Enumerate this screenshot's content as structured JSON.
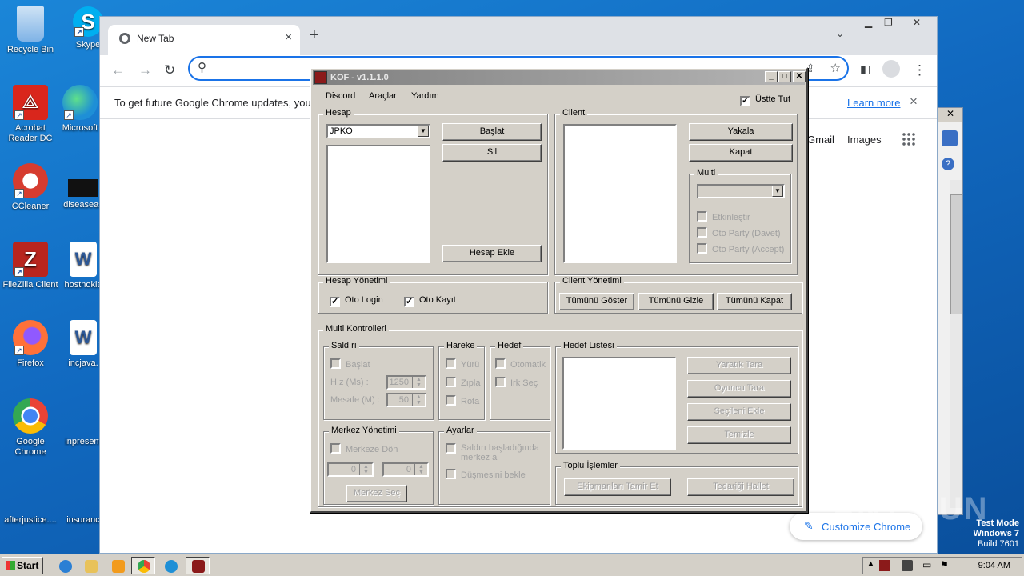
{
  "desktop": {
    "icons": [
      {
        "label": "Recycle Bin",
        "color": "#7fb3e6"
      },
      {
        "label": "Skype",
        "color": "#00aff0"
      },
      {
        "label": "Acrobat Reader DC",
        "color": "#d9261c"
      },
      {
        "label": "Microsoft",
        "color": "#1e8fd6"
      },
      {
        "label": "CCleaner",
        "color": "#d63c2f"
      },
      {
        "label": "diseaseas",
        "color": "#111111"
      },
      {
        "label": "FileZilla Client",
        "color": "#b8251e"
      },
      {
        "label": "hostnokia",
        "color": "#2b5797"
      },
      {
        "label": "Firefox",
        "color": "#ff7139"
      },
      {
        "label": "incjava.",
        "color": "#2b5797"
      },
      {
        "label": "Google Chrome",
        "color": "#4285f4"
      },
      {
        "label": "inpresent",
        "color": "#2b5797"
      },
      {
        "label": "afterjustice....",
        "color": "#1573c7"
      },
      {
        "label": "insuranc",
        "color": "#1573c7"
      }
    ]
  },
  "chrome": {
    "tab_title": "New Tab",
    "tab_close": "×",
    "new_tab": "+",
    "tab_dropdown": "⌄",
    "infobar_message": "To get future Google Chrome updates, you'll",
    "learn_more": "Learn more",
    "infobar_close": "×",
    "gmail": "Gmail",
    "images": "Images",
    "customize": "Customize Chrome"
  },
  "kof": {
    "title": "KOF - v1.1.1.0",
    "menu": [
      "Discord",
      "Araçlar",
      "Yardım"
    ],
    "always_on_top": "Üstte Tut",
    "hesap": {
      "label": "Hesap",
      "selected": "JPKO",
      "baslat": "Başlat",
      "sil": "Sil",
      "hesap_ekle": "Hesap Ekle"
    },
    "client": {
      "label": "Client",
      "yakala": "Yakala",
      "kapat": "Kapat",
      "multi": "Multi",
      "etkinlestir": "Etkinleştir",
      "oto_party_davet": "Oto Party (Davet)",
      "oto_party_accept": "Oto Party (Accept)"
    },
    "hesap_yonetimi": {
      "label": "Hesap Yönetimi",
      "oto_login": "Oto Login",
      "oto_kayit": "Oto Kayıt"
    },
    "client_yonetimi": {
      "label": "Client Yönetimi",
      "tumunu_goster": "Tümünü Göster",
      "tumunu_gizle": "Tümünü Gizle",
      "tumunu_kapat": "Tümünü Kapat"
    },
    "multi_kontrolleri": {
      "label": "Multi Kontrolleri",
      "saldiri": "Saldırı",
      "baslat": "Başlat",
      "hiz_label": "Hız (Ms) :",
      "hiz_value": "1250",
      "mesafe_label": "Mesafe (M) :",
      "mesafe_value": "50",
      "hareket": "Hareke",
      "yuru": "Yürü",
      "zipla": "Zıpla",
      "rota": "Rota",
      "hedef": "Hedef",
      "otomatik": "Otomatik",
      "irk_sec": "Irk Seç",
      "merkez_yonetimi": "Merkez Yönetimi",
      "merkeze_don": "Merkeze Dön",
      "merkez_x": "0",
      "merkez_y": "0",
      "merkez_sec": "Merkez Seç",
      "ayarlar": "Ayarlar",
      "saldiri_basladiginda": "Saldırı başladığında merkez al",
      "dusmesini_bekle": "Düşmesini bekle"
    },
    "hedef_listesi": {
      "label": "Hedef Listesi",
      "yaratik_tara": "Yaratık Tara",
      "oyuncu_tara": "Oyuncu Tara",
      "secileni_ekle": "Seçileni Ekle",
      "temizle": "Temizle"
    },
    "toplu_islemler": {
      "label": "Toplu İşlemler",
      "ekipmanlari_tamir": "Ekipmanları Tamir Et",
      "tedarigi_hallet": "Tedariği Hallet"
    }
  },
  "taskbar": {
    "start": "Start",
    "clock": "9:04 AM"
  },
  "watermark": {
    "line1": "Test Mode",
    "line2": "Windows 7",
    "line3": "Build 7601",
    "brand": "ANY RUN"
  }
}
